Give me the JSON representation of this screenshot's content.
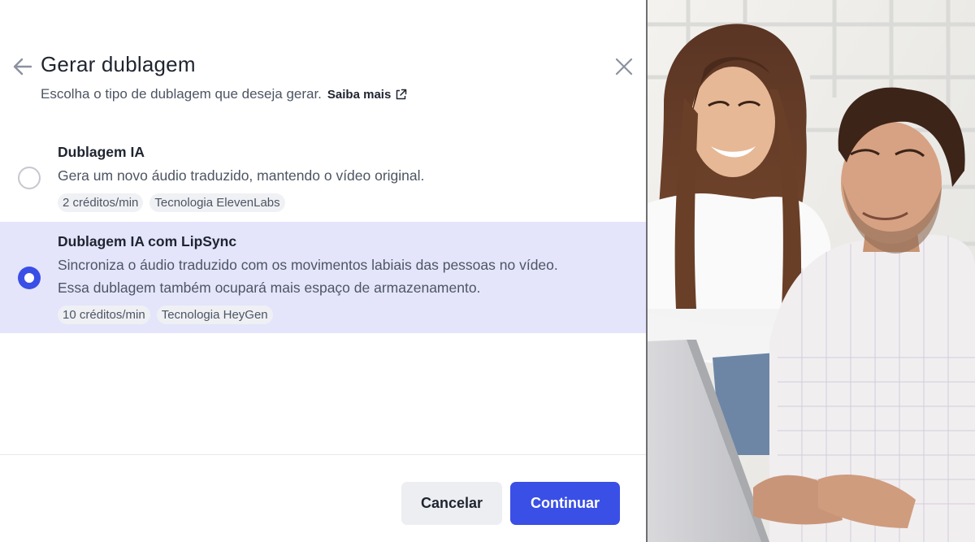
{
  "dialog": {
    "title": "Gerar dublagem",
    "subtitle": "Escolha o tipo de dublagem que deseja gerar.",
    "learn_more": "Saiba mais",
    "options": [
      {
        "title": "Dublagem IA",
        "description": "Gera um novo áudio traduzido, mantendo o vídeo original.",
        "tags": [
          "2 créditos/min",
          "Tecnologia ElevenLabs"
        ],
        "selected": false
      },
      {
        "title": "Dublagem IA com LipSync",
        "description_line1": "Sincroniza o áudio traduzido com os movimentos labiais das pessoas no vídeo.",
        "description_line2": "Essa dublagem também ocupará mais espaço de armazenamento.",
        "tags": [
          "10 créditos/min",
          "Tecnologia HeyGen"
        ],
        "selected": true
      }
    ],
    "buttons": {
      "cancel": "Cancelar",
      "continue": "Continuar"
    }
  },
  "colors": {
    "accent": "#3a4fe6",
    "selected_bg": "#e4e5fb",
    "text_primary": "#1f2430",
    "text_secondary": "#4d5563"
  },
  "icons": {
    "back": "arrow-left-icon",
    "close": "close-icon",
    "external": "external-link-icon"
  }
}
